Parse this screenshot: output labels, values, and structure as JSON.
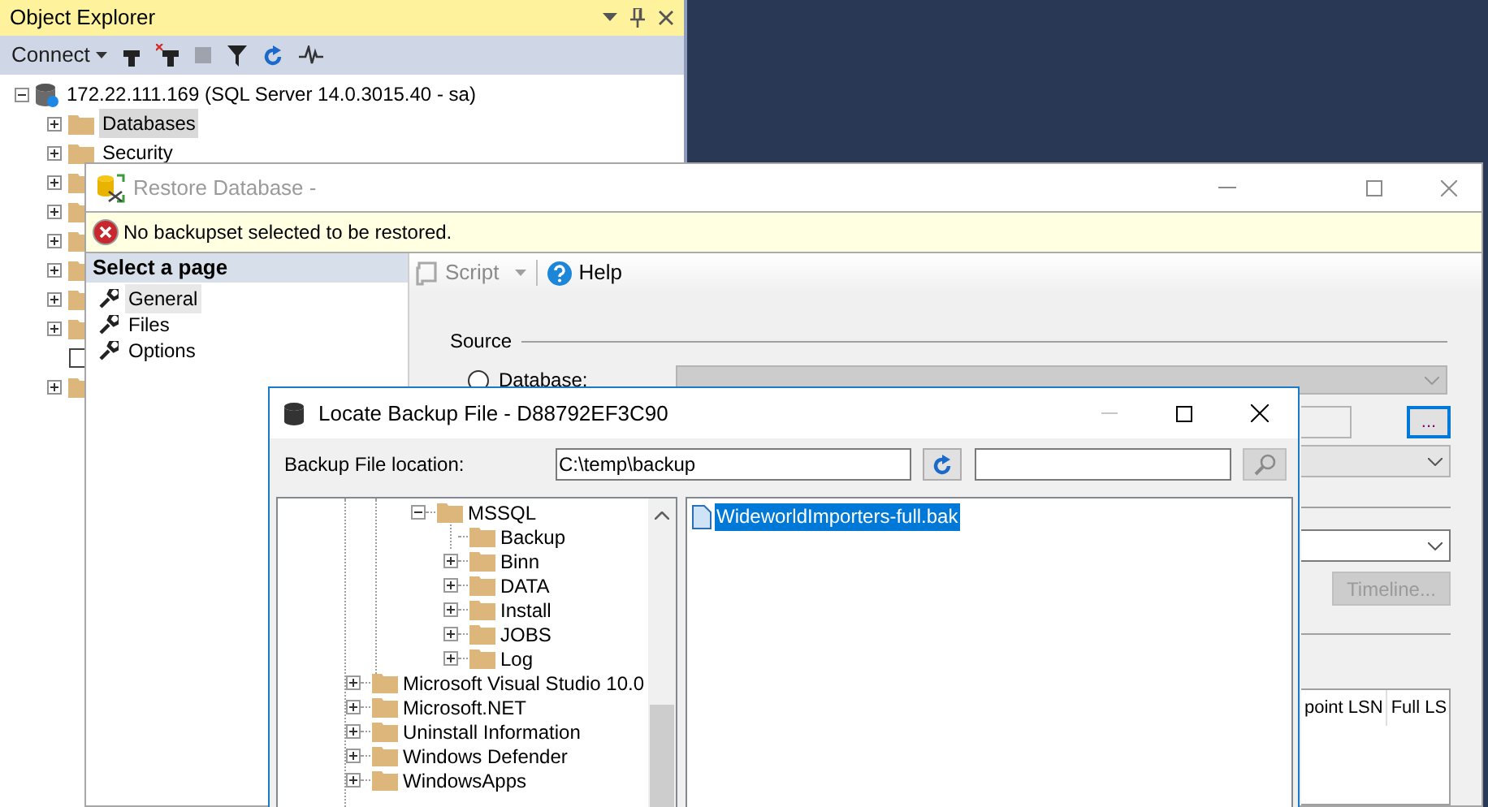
{
  "object_explorer": {
    "title": "Object Explorer",
    "connect": "Connect",
    "tree": [
      {
        "label": "172.22.111.169 (SQL Server 14.0.3015.40 - sa)",
        "expanded": true,
        "selected": false,
        "leaf": false,
        "children": [
          {
            "label": "Databases",
            "expanded": false,
            "selected": true,
            "leaf": false
          },
          {
            "label": "Security",
            "expanded": false,
            "selected": false,
            "leaf": false
          },
          {
            "expanded": false,
            "leaf": false
          },
          {
            "expanded": false,
            "leaf": false
          },
          {
            "expanded": false,
            "leaf": false
          },
          {
            "expanded": false,
            "leaf": false
          },
          {
            "expanded": false,
            "leaf": false
          },
          {
            "expanded": false,
            "leaf": false
          },
          {
            "expanded": false,
            "leaf": true
          },
          {
            "expanded": false,
            "leaf": false
          }
        ]
      }
    ]
  },
  "restore_dialog": {
    "title": "Restore Database -",
    "message": {
      "kind": "error",
      "text": "No backupset selected to be restored."
    },
    "pages_header": "Select a page",
    "pages": [
      {
        "label": "General",
        "selected": true
      },
      {
        "label": "Files",
        "selected": false
      },
      {
        "label": "Options",
        "selected": false
      }
    ],
    "toolbar": [
      {
        "label": "Script",
        "kind": "script",
        "disabled": true
      },
      {
        "label": "Help",
        "kind": "help",
        "disabled": false
      }
    ],
    "source_label": "Source",
    "database_option": {
      "label": "Database:",
      "selected": false
    },
    "browse_button": "...",
    "timeline_button": {
      "label": "Timeline...",
      "disabled": true
    },
    "grid_columns": [
      "point LSN",
      "Full LS"
    ]
  },
  "locate_dialog": {
    "title": "Locate Backup File - D88792EF3C90",
    "location_label": "Backup File location:",
    "location_value": "C:\\temp\\backup",
    "tree": [
      {
        "label": "MSSQL",
        "expanded": true,
        "leaf": false,
        "children": [
          {
            "label": "Backup",
            "expanded": false,
            "leaf": true
          },
          {
            "label": "Binn",
            "expanded": false,
            "leaf": false
          },
          {
            "label": "DATA",
            "expanded": false,
            "leaf": false
          },
          {
            "label": "Install",
            "expanded": false,
            "leaf": false
          },
          {
            "label": "JOBS",
            "expanded": false,
            "leaf": false
          },
          {
            "label": "Log",
            "expanded": false,
            "leaf": false
          }
        ]
      },
      {
        "label": "Microsoft Visual Studio 10.0",
        "expanded": false,
        "leaf": false
      },
      {
        "label": "Microsoft.NET",
        "expanded": false,
        "leaf": false
      },
      {
        "label": "Uninstall Information",
        "expanded": false,
        "leaf": false
      },
      {
        "label": "Windows Defender",
        "expanded": false,
        "leaf": false
      },
      {
        "label": "WindowsApps",
        "expanded": false,
        "leaf": false
      }
    ],
    "files": [
      {
        "name": "WideworldImporters-full.bak",
        "selected": true
      }
    ]
  }
}
